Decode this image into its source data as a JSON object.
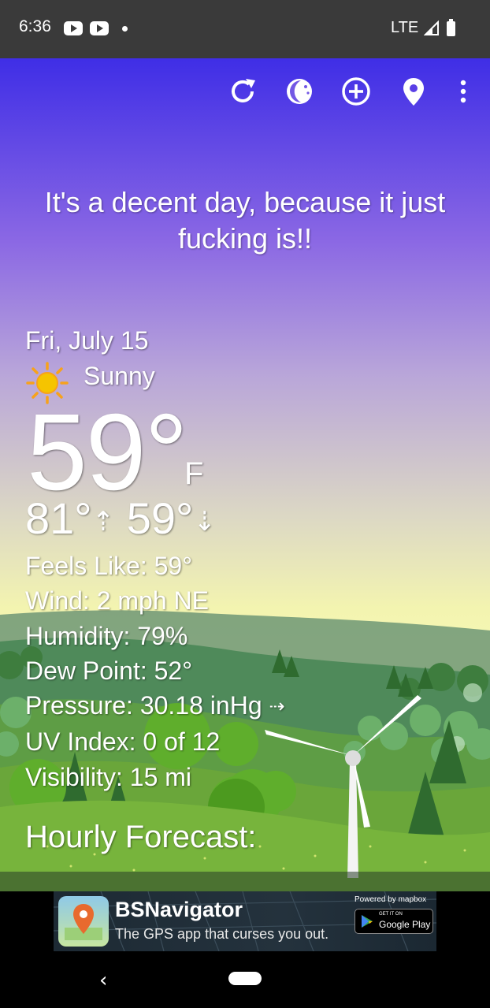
{
  "status_bar": {
    "time": "6:36",
    "network": "LTE"
  },
  "toolbar": {
    "icons": [
      "refresh-icon",
      "theme-icon",
      "add-location-icon",
      "location-pin-icon",
      "more-options-icon"
    ]
  },
  "headline": "It's a decent day, because it just fucking is!!",
  "current": {
    "date": "Fri, July 15",
    "condition": "Sunny",
    "condition_icon": "sun-icon",
    "temperature": "59°",
    "unit": "F",
    "high": "81°",
    "low": "59°"
  },
  "details": {
    "feels_like": "Feels Like:  59°",
    "wind": "Wind:  2 mph NE",
    "humidity": "Humidity:  79%",
    "dew_point": "Dew Point:  52°",
    "pressure": "Pressure:  30.18 inHg",
    "uv_index": "UV Index:  0 of 12",
    "visibility": "Visibility:  15 mi"
  },
  "hourly_title": "Hourly Forecast:",
  "ad": {
    "title": "BSNavigator",
    "subtitle": "The GPS app that curses you out.",
    "powered_by": "Powered by mapbox",
    "store_small": "GET IT ON",
    "store_big": "Google Play"
  },
  "nav": {
    "back_glyph": "‹"
  },
  "colors": {
    "sky_top": "#3f2ee6",
    "sky_mid": "#b9a6d9",
    "sky_bottom": "#f3f4b0",
    "grass": "#6aa63a"
  }
}
